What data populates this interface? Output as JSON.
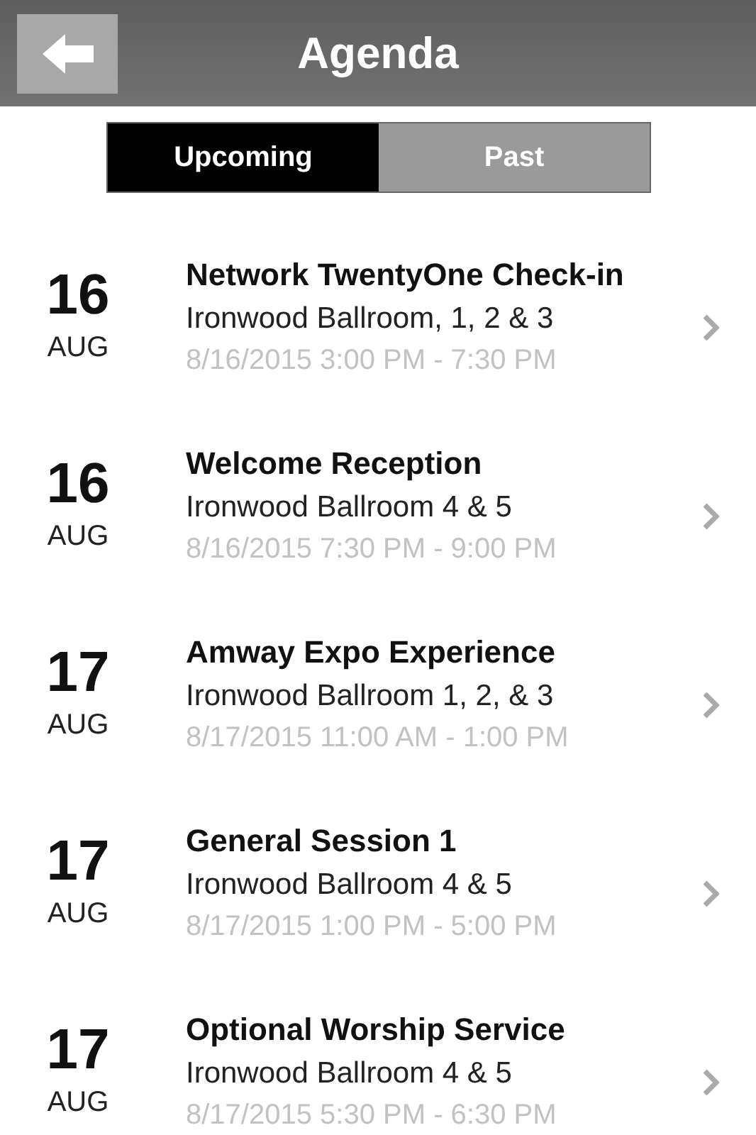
{
  "header": {
    "title": "Agenda"
  },
  "tabs": [
    {
      "label": "Upcoming",
      "selected": true
    },
    {
      "label": "Past",
      "selected": false
    }
  ],
  "events": [
    {
      "day": "16",
      "month": "AUG",
      "title": "Network TwentyOne Check-in",
      "location": "Ironwood Ballroom, 1, 2 & 3",
      "time": "8/16/2015 3:00 PM - 7:30 PM"
    },
    {
      "day": "16",
      "month": "AUG",
      "title": "Welcome Reception",
      "location": "Ironwood Ballroom 4 & 5",
      "time": "8/16/2015 7:30 PM - 9:00 PM"
    },
    {
      "day": "17",
      "month": "AUG",
      "title": "Amway Expo Experience",
      "location": "Ironwood Ballroom 1, 2, & 3",
      "time": "8/17/2015 11:00 AM - 1:00 PM"
    },
    {
      "day": "17",
      "month": "AUG",
      "title": "General Session 1",
      "location": "Ironwood Ballroom 4 & 5",
      "time": "8/17/2015 1:00 PM - 5:00 PM"
    },
    {
      "day": "17",
      "month": "AUG",
      "title": "Optional Worship Service",
      "location": "Ironwood Ballroom 4 & 5",
      "time": "8/17/2015 5:30 PM - 6:30 PM"
    }
  ]
}
